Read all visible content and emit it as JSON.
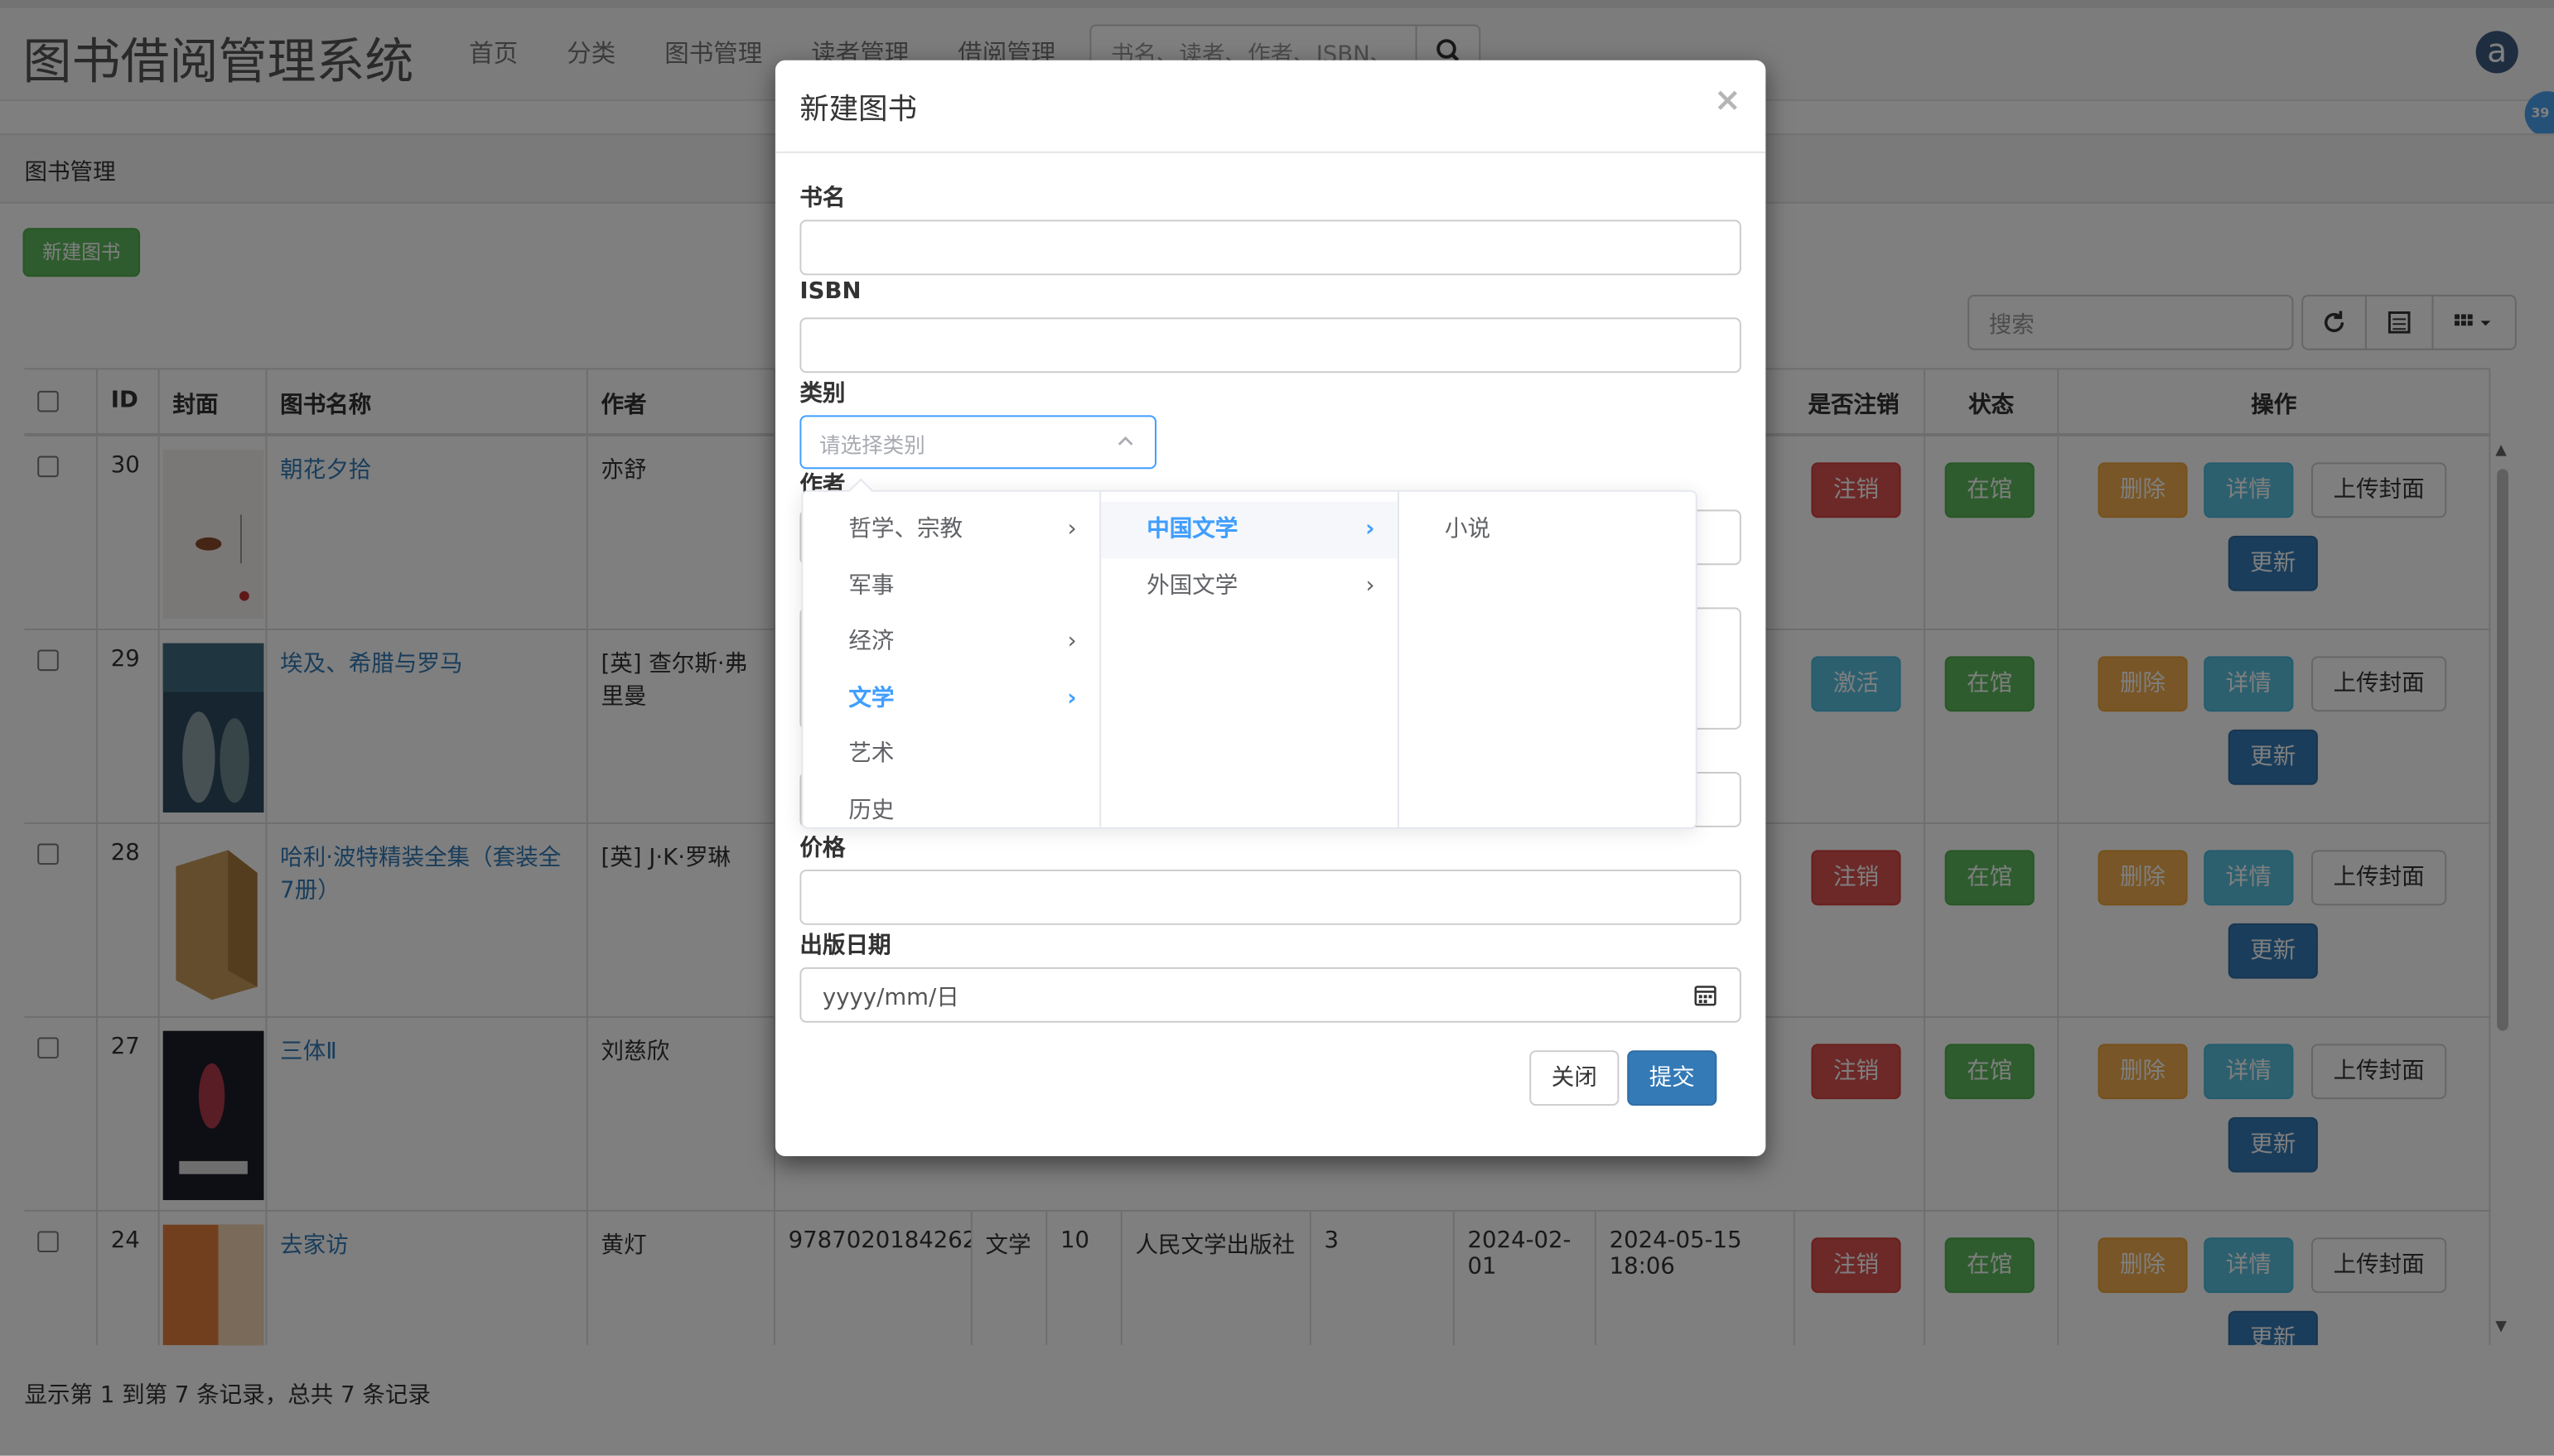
{
  "app": {
    "title": "图书借阅管理系统"
  },
  "nav": {
    "links": [
      "首页",
      "分类",
      "图书管理",
      "读者管理",
      "借阅管理"
    ],
    "search_placeholder": "书名、读者、作者、ISBN、",
    "avatar_letter": "a",
    "side_badge": "39"
  },
  "breadcrumb": "图书管理",
  "toolbar": {
    "new_book": "新建图书",
    "search_placeholder": "搜索"
  },
  "table": {
    "headers": [
      "ID",
      "封面",
      "图书名称",
      "作者",
      "是否注销",
      "状态",
      "操作"
    ],
    "rows": [
      {
        "id": "30",
        "title": "朝花夕拾",
        "author": "亦舒",
        "cancel": "注销",
        "cancel_type": "danger",
        "status": "在馆"
      },
      {
        "id": "29",
        "title": "埃及、希腊与罗马",
        "author": "[英] 查尔斯·弗里曼",
        "cancel": "激活",
        "cancel_type": "info",
        "status": "在馆"
      },
      {
        "id": "28",
        "title": "哈利·波特精装全集（套装全7册）",
        "author": "[英] J·K·罗琳",
        "cancel": "注销",
        "cancel_type": "danger",
        "status": "在馆"
      },
      {
        "id": "27",
        "title": "三体Ⅱ",
        "author": "刘慈欣",
        "cancel": "注销",
        "cancel_type": "danger",
        "status": "在馆"
      },
      {
        "id": "24",
        "title": "去家访",
        "author": "黄灯",
        "isbn": "9787020184262",
        "category": "文学",
        "stock": "10",
        "publisher": "人民文学出版社",
        "count": "3",
        "date": "2024-02-01",
        "created": "2024-05-15 18:06",
        "cancel": "注销",
        "cancel_type": "danger",
        "status": "在馆"
      }
    ],
    "actions": {
      "delete": "删除",
      "detail": "详情",
      "upload": "上传封面",
      "update": "更新"
    }
  },
  "footer": "显示第 1 到第 7 条记录，总共 7 条记录",
  "modal": {
    "title": "新建图书",
    "close_x": "×",
    "fields": {
      "name": "书名",
      "isbn": "ISBN",
      "category": "类别",
      "author": "作者",
      "price": "价格",
      "pub_date": "出版日期"
    },
    "category_placeholder": "请选择类别",
    "date_placeholder": "yyyy/mm/日",
    "close_btn": "关闭",
    "submit_btn": "提交"
  },
  "cascader": {
    "level1": [
      "哲学、宗教",
      "军事",
      "经济",
      "文学",
      "艺术",
      "历史"
    ],
    "level2": [
      "中国文学",
      "外国文学"
    ],
    "level3": [
      "小说"
    ]
  },
  "colors": {
    "accent": "#409eff",
    "primary": "#337ab7",
    "success": "#5cb85c",
    "danger": "#d9534f",
    "warning": "#f0ad4e",
    "info": "#5bc0de"
  }
}
